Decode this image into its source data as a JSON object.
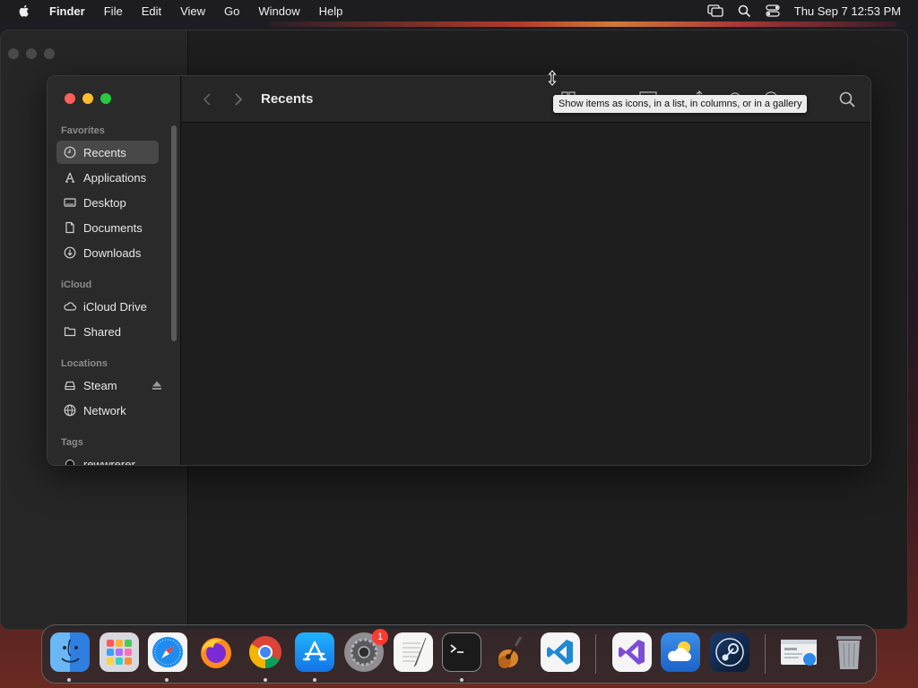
{
  "menubar": {
    "app_name": "Finder",
    "menus": [
      "File",
      "Edit",
      "View",
      "Go",
      "Window",
      "Help"
    ],
    "clock": "Thu Sep 7  12:53 PM"
  },
  "finder": {
    "title": "Recents",
    "tooltip": "Show items as icons, in a list, in columns, or in a gallery",
    "sidebar": {
      "favorites_title": "Favorites",
      "favorites": [
        "Recents",
        "Applications",
        "Desktop",
        "Documents",
        "Downloads"
      ],
      "icloud_title": "iCloud",
      "icloud": [
        "iCloud Drive",
        "Shared"
      ],
      "locations_title": "Locations",
      "locations": [
        "Steam",
        "Network"
      ],
      "tags_title": "Tags",
      "tags": [
        "rewwrerer"
      ]
    }
  },
  "dock": {
    "apps": [
      "finder-icon",
      "launchpad-icon",
      "safari-icon",
      "firefox-icon",
      "chrome-icon",
      "app-store-icon",
      "system-settings-icon",
      "textedit-icon",
      "terminal-icon",
      "garageband-icon",
      "vscode-icon",
      "visual-studio-icon",
      "weather-icon",
      "steam-icon",
      "preview-icon",
      "trash-icon"
    ],
    "settings_badge": "1"
  },
  "colors": {
    "close": "#fe5f57",
    "minimize": "#febc2e",
    "zoom": "#28c840",
    "selection": "#484848",
    "badge": "#ff3b30"
  }
}
